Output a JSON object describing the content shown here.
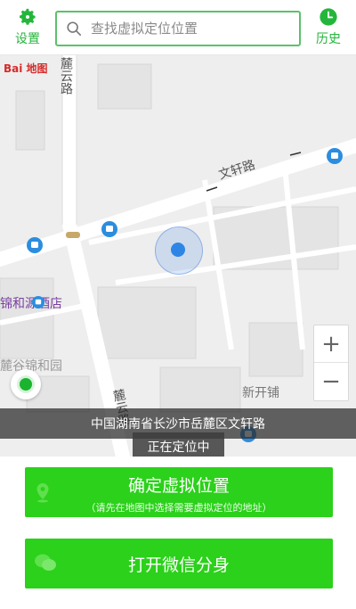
{
  "topbar": {
    "settings_label": "设置",
    "history_label": "历史",
    "search_placeholder": "查找虚拟定位位置"
  },
  "map": {
    "logo_text": "Bai 地图",
    "road_labels": {
      "luyun_top": "麓云路",
      "wenxuan": "文轩路",
      "luyun_bottom": "麓云路"
    },
    "poi_hotel": "锦和源酒店",
    "block_heyuan": "麓谷锦和园",
    "block_xinkaipu": "新开铺",
    "zoom_in": "+",
    "zoom_out": "−",
    "address": "中国湖南省长沙市岳麓区文轩路",
    "toast": "正在定位中",
    "accent_color": "#2bd11a",
    "location_color": "#2f85e6"
  },
  "actions": {
    "confirm_title": "确定虚拟位置",
    "confirm_subtitle": "（请先在地图中选择需要虚拟定位的地址）",
    "wechat_label": "打开微信分身"
  }
}
